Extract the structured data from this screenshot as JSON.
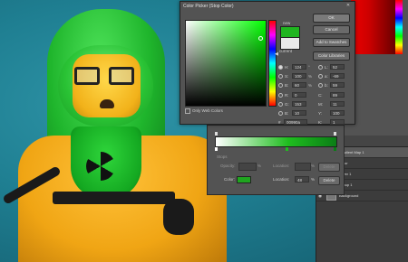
{
  "color_picker": {
    "title": "Color Picker (Stop Color)",
    "new_label": "new",
    "current_label": "current",
    "buttons": {
      "ok": "OK",
      "cancel": "Cancel",
      "add_to_swatches": "Add to Swatches",
      "color_libraries": "Color Libraries"
    },
    "only_web_colors": "Only Web Colors",
    "hsb": {
      "h": "124",
      "s": "100",
      "b": "60"
    },
    "rgb": {
      "r": "0",
      "g": "153",
      "b": "10"
    },
    "lab": {
      "l": "52",
      "a": "-69",
      "b": "59"
    },
    "cmyk": {
      "c": "89",
      "m": "11",
      "y": "100",
      "k": "1"
    },
    "hex": "00990a",
    "new_color": "#00990a",
    "current_color": "#e9e9e9"
  },
  "gradient_editor": {
    "stops_label": "Stops",
    "opacity_label": "Opacity:",
    "location_label": "Location:",
    "delete_label": "Delete",
    "color_label": "Color:",
    "color_location_value": "48",
    "percent": "%",
    "stop_color": "#1fa51f"
  },
  "layers_panel": {
    "layers": [
      {
        "name": "Gradient Map 1",
        "selected": true
      },
      {
        "name": "Color",
        "selected": false
      },
      {
        "name": "Layer 1",
        "selected": false
      },
      {
        "name": "Group 1",
        "selected": false
      },
      {
        "name": "Background",
        "selected": false
      }
    ]
  }
}
